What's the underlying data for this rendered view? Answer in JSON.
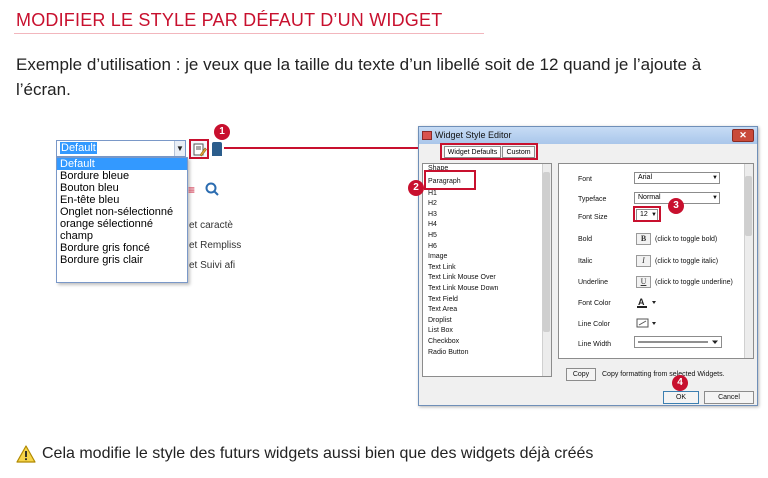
{
  "title": "MODIFIER LE STYLE PAR DÉFAUT D’UN WIDGET",
  "intro": "Exemple d’utilisation : je veux que la taille du texte d’un libellé soit de 12 quand je l’ajoute à l’écran.",
  "combo": {
    "value": "Default",
    "options": [
      "Default",
      "Bordure bleue",
      "Bouton bleu",
      "En-tête bleu",
      "Onglet non-sélectionné",
      "orange sélectionné",
      "champ",
      "Bordure gris foncé",
      "Bordure gris clair"
    ]
  },
  "behind": [
    "et caractè",
    "et Rempliss",
    "et Suivi afi"
  ],
  "badges": [
    "1",
    "2",
    "3",
    "4"
  ],
  "dialog": {
    "title": "Widget Style Editor",
    "close": "✕",
    "tabs": [
      "Widget Defaults",
      "Custom"
    ],
    "widgets": [
      "Shape",
      "Paragraph",
      "H1",
      "H2",
      "H3",
      "H4",
      "H5",
      "H6",
      "Image",
      "Text Link",
      "Text Link Mouse Over",
      "Text Link Mouse Down",
      "Text Field",
      "Text Area",
      "Droplist",
      "List Box",
      "Checkbox",
      "Radio Button"
    ],
    "font_label": "Font",
    "font_value": "Arial",
    "typeface_label": "Typeface",
    "typeface_value": "Normal",
    "fontsize_label": "Font Size",
    "fontsize_value": "12",
    "bold_label": "Bold",
    "bold_btn": "B",
    "bold_hint": "(click to toggle bold)",
    "italic_label": "Italic",
    "italic_btn": "I",
    "italic_hint": "(click to toggle italic)",
    "underline_label": "Underline",
    "underline_btn": "U",
    "underline_hint": "(click to toggle underline)",
    "fontcolor_label": "Font Color",
    "linecolor_label": "Line Color",
    "linewidth_label": "Line Width",
    "copy_btn": "Copy",
    "copy_hint": "Copy formatting from selected Widgets.",
    "ok": "OK",
    "cancel": "Cancel"
  },
  "warning": "Cela modifie le style des futurs widgets aussi bien que des widgets déjà créés",
  "colors": {
    "accent": "#c8102e",
    "selection": "#3399ff",
    "warning": "#f2c200"
  }
}
